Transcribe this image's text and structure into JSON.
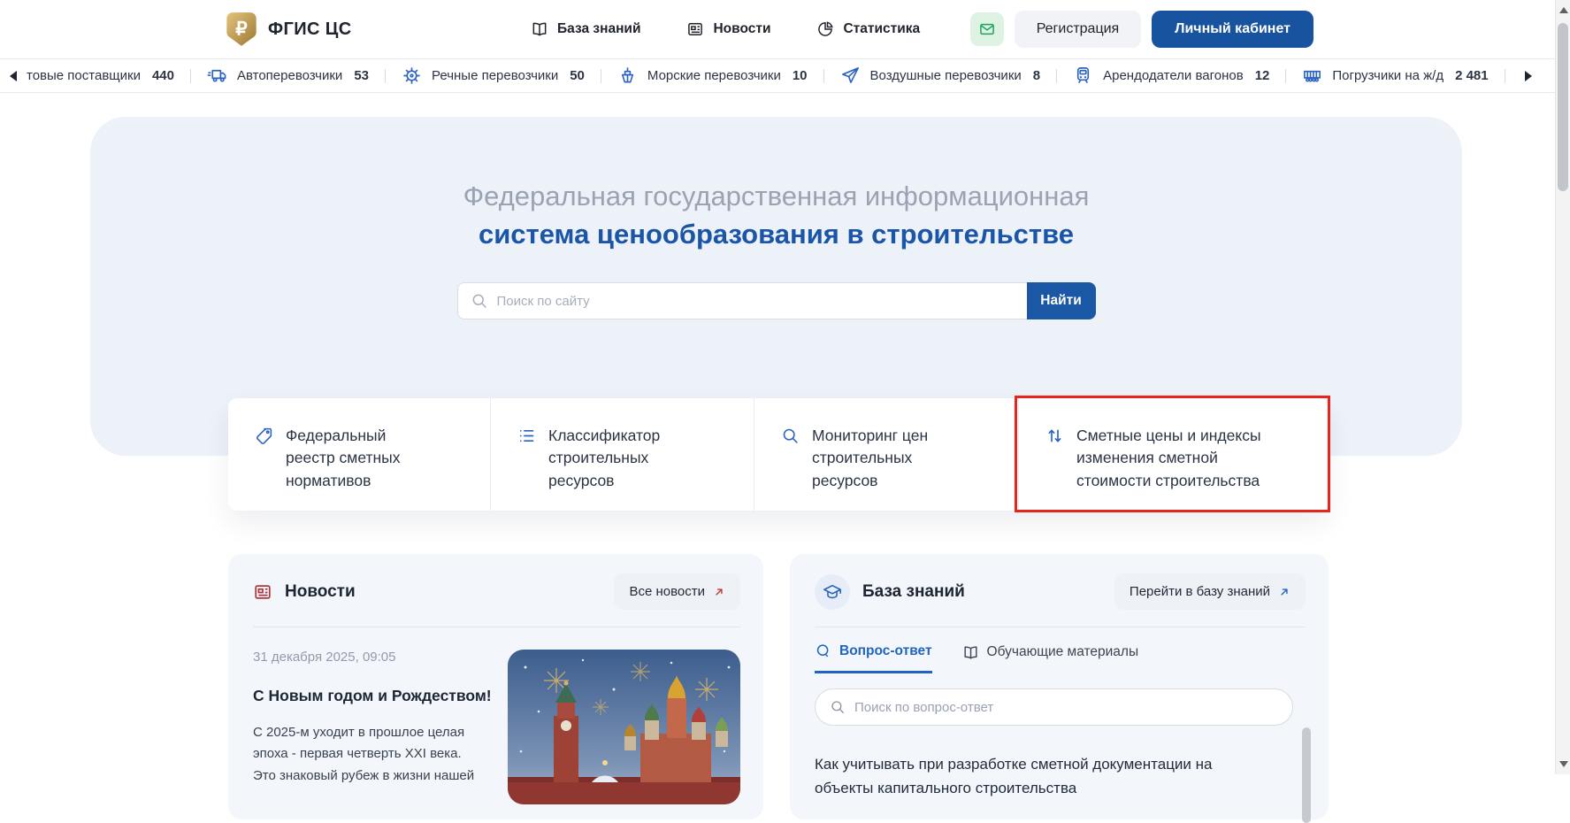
{
  "header": {
    "logo_text": "ФГИС ЦС",
    "nav": [
      {
        "icon": "book-icon",
        "label": "База знаний"
      },
      {
        "icon": "news-icon",
        "label": "Новости"
      },
      {
        "icon": "stats-icon",
        "label": "Статистика"
      }
    ],
    "register_label": "Регистрация",
    "account_label": "Личный кабинет"
  },
  "ticker": {
    "items": [
      {
        "icon": "none",
        "label": "товые поставщики",
        "count": "440"
      },
      {
        "icon": "truck-icon",
        "label": "Автоперевозчики",
        "count": "53"
      },
      {
        "icon": "helm-icon",
        "label": "Речные перевозчики",
        "count": "50"
      },
      {
        "icon": "ship-icon",
        "label": "Морские перевозчики",
        "count": "10"
      },
      {
        "icon": "plane-icon",
        "label": "Воздушные перевозчики",
        "count": "8"
      },
      {
        "icon": "train-icon",
        "label": "Арендодатели вагонов",
        "count": "12"
      },
      {
        "icon": "wagon-icon",
        "label": "Погрузчики на ж/д",
        "count": "2 481"
      }
    ]
  },
  "hero": {
    "title_line1": "Федеральная государственная информационная",
    "title_line2": "система ценообразования в строительстве",
    "search_placeholder": "Поиск по сайту",
    "search_button": "Найти"
  },
  "quick_links": [
    {
      "icon": "tag-icon",
      "label": "Федеральный реестр сметных нормативов"
    },
    {
      "icon": "list-icon",
      "label": "Классификатор строительных ресурсов"
    },
    {
      "icon": "search-icon",
      "label": "Мониторинг цен строительных ресурсов"
    },
    {
      "icon": "sort-arrows-icon",
      "label": "Сметные цены и индексы изменения сметной стоимости строительства",
      "highlighted": true
    }
  ],
  "news": {
    "title": "Новости",
    "all_button": "Все новости",
    "item": {
      "date": "31 декабря 2025, 09:05",
      "title": "С Новым годом и Рождеством!",
      "lines": [
        "С 2025-м уходит в прошлое целая",
        "эпоха - первая четверть XXI века.",
        "Это знаковый рубеж в жизни нашей"
      ]
    }
  },
  "knowledge": {
    "title": "База знаний",
    "go_button": "Перейти в базу знаний",
    "tabs": [
      {
        "label": "Вопрос-ответ",
        "active": true
      },
      {
        "label": "Обучающие материалы",
        "active": false
      }
    ],
    "search_placeholder": "Поиск по вопрос-ответ",
    "question_line1": "Как учитывать при разработке сметной документации на",
    "question_line2": "объекты капитального строительства"
  },
  "colors": {
    "accent_blue": "#17539f",
    "link_blue": "#1f64c0",
    "icon_blue": "#2b63c1",
    "highlight_red": "#e8251c",
    "news_red": "#ab3a3e",
    "mail_green": "#1ea35b",
    "hero_bg": "#edf1f8",
    "panel_bg": "#f3f6fa",
    "title_gray": "#9aa3b2"
  }
}
